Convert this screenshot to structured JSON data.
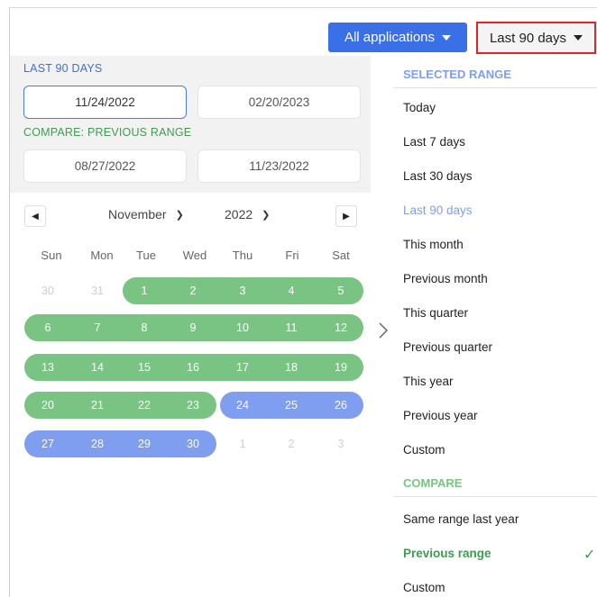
{
  "toolbar": {
    "apps_label": "All applications",
    "range_label": "Last 90 days"
  },
  "range_panel": {
    "range_title": "LAST 90 DAYS",
    "range_start": "11/24/2022",
    "range_end": "02/20/2023",
    "compare_title": "COMPARE: PREVIOUS RANGE",
    "compare_start": "08/27/2022",
    "compare_end": "11/23/2022"
  },
  "calendar": {
    "prev_icon": "◀",
    "next_icon": "▶",
    "month": "November",
    "year": "2022",
    "weekdays": [
      "Sun",
      "Mon",
      "Tue",
      "Wed",
      "Thu",
      "Fri",
      "Sat"
    ],
    "weeks": [
      [
        "30",
        "31",
        "1",
        "2",
        "3",
        "4",
        "5"
      ],
      [
        "6",
        "7",
        "8",
        "9",
        "10",
        "11",
        "12"
      ],
      [
        "13",
        "14",
        "15",
        "16",
        "17",
        "18",
        "19"
      ],
      [
        "20",
        "21",
        "22",
        "23",
        "24",
        "25",
        "26"
      ],
      [
        "27",
        "28",
        "29",
        "30",
        "1",
        "2",
        "3"
      ]
    ],
    "colors": {
      "compare": "#79c383",
      "range": "#7f9ef0"
    }
  },
  "menu": {
    "selected_range_title": "SELECTED RANGE",
    "ranges": [
      "Today",
      "Last 7 days",
      "Last 30 days",
      "Last 90 days",
      "This month",
      "Previous month",
      "This quarter",
      "Previous quarter",
      "This year",
      "Previous year",
      "Custom"
    ],
    "compare_title": "COMPARE",
    "compare_options": [
      "Same range last year",
      "Previous range",
      "Custom"
    ],
    "check_icon": "✓"
  }
}
